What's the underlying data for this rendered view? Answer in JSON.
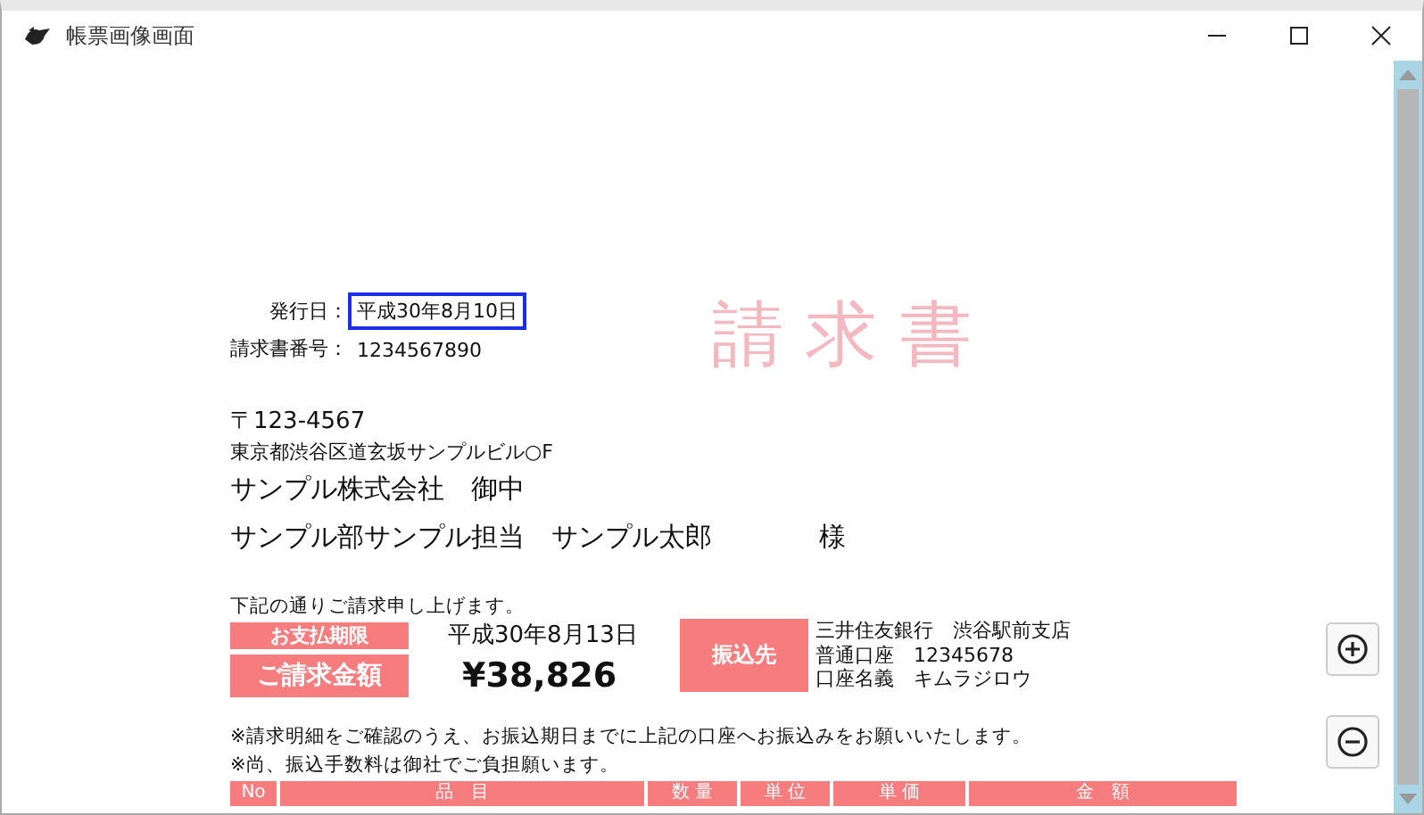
{
  "window": {
    "title": "帳票画像画面"
  },
  "invoice": {
    "title": "請 求 書",
    "meta": [
      {
        "label": "発行日：",
        "value": "平成30年8月10日",
        "highlighted": true
      },
      {
        "label": "請求書番号：",
        "value": "1234567890",
        "highlighted": false
      }
    ],
    "postal_code": "〒123-4567",
    "address": "東京都渋谷区道玄坂サンプルビル○F",
    "company": "サンプル株式会社　御中",
    "person": "サンプル部サンプル担当　サンプル太郎",
    "honorific": "様",
    "intro": "下記の通りご請求申し上げます。",
    "due_label": "お支払期限",
    "due_date": "平成30年8月13日",
    "amount_label": "ご請求金額",
    "amount": "¥38,826",
    "bank_label": "振込先",
    "bank_lines": [
      "三井住友銀行　渋谷駅前支店",
      "普通口座　12345678",
      "口座名義　キムラジロウ"
    ],
    "notes": [
      "※請求明細をご確認のうえ、お振込期日までに上記の口座へお振込みをお願いいたします。",
      "※尚、振込手数料は御社でご負担願います。"
    ],
    "table": {
      "columns": [
        "No",
        "品　目",
        "数 量",
        "単 位",
        "単 価",
        "金　額"
      ]
    }
  }
}
